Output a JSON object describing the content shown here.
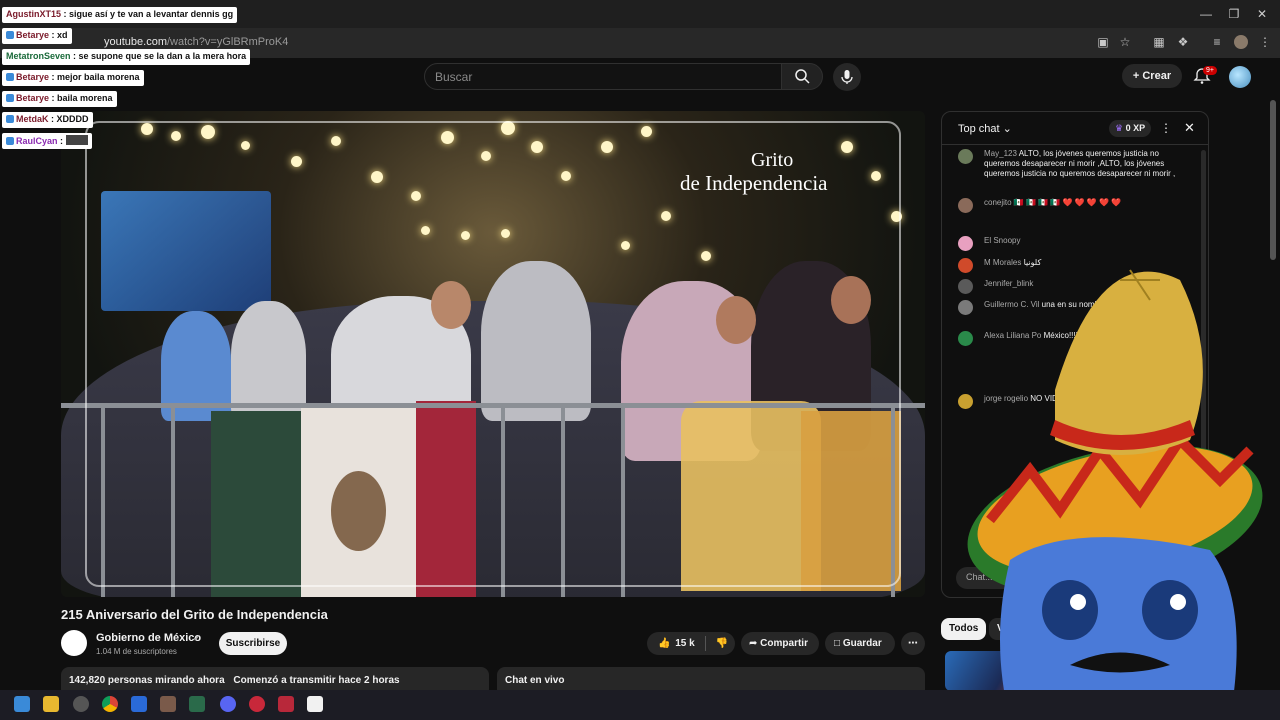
{
  "browser": {
    "url_host": "youtube.com",
    "url_path": "/watch?v=yGlBRmProK4"
  },
  "header": {
    "search_placeholder": "Buscar",
    "create_label": "Crear",
    "notif_badge": "9+"
  },
  "video": {
    "overlay_title_line1": "Grito",
    "overlay_title_line2": "de Independencia",
    "title": "215 Aniversario del Grito de Independencia",
    "channel_name": "Gobierno de México",
    "subscribers": "1.04 M de suscriptores",
    "subscribe_label": "Suscribirse",
    "likes": "15 k",
    "share_label": "Compartir",
    "save_label": "Guardar",
    "watching": "142,820 personas mirando ahora",
    "started": "Comenzó a transmitir hace 2 horas",
    "live_chat_label": "Chat en vivo"
  },
  "chat": {
    "header_title": "Top chat",
    "xp": "0 XP",
    "input_placeholder": "Chat...",
    "messages": [
      {
        "author": "May_123",
        "text": "ALTO, los jóvenes queremos justicia no queremos desaparecer ni morir ,ALTO, los jóvenes queremos justicia no queremos desaparecer ni morir ,"
      },
      {
        "author": "conejito",
        "text": "🇲🇽 🇲🇽 🇲🇽 🇲🇽 ❤️ ❤️ ❤️ ❤️ ❤️"
      },
      {
        "author": "El Snoopy",
        "text": ""
      },
      {
        "author": "M Morales",
        "text": "كلونيا"
      },
      {
        "author": "Jennifer_blink",
        "text": ""
      },
      {
        "author": "Guillermo C. Vil",
        "text": "una en su nomb"
      },
      {
        "author": "Alexa Liliana Po",
        "text": "México!!!!!!!!!!!"
      },
      {
        "author": "jorge rogelio",
        "text": "NO VIDEOJUEGOS"
      }
    ]
  },
  "tabs": {
    "todos": "Todos",
    "videos": "Vide"
  },
  "overlay_chat": [
    {
      "user": "AgustinXT15",
      "text": "sigue así y te van a levantar dennis gg"
    },
    {
      "user": "Betarye",
      "text": "xd"
    },
    {
      "user": "MetatronSeven",
      "text": "se supone que se la dan a la mera hora"
    },
    {
      "user": "Betarye",
      "text": "mejor baila morena"
    },
    {
      "user": "Betarye",
      "text": "baila morena"
    },
    {
      "user": "MetdaK",
      "text": "XDDDD"
    },
    {
      "user": "RaulCyan",
      "text": ""
    }
  ],
  "colors": {
    "bg": "#0f0f0f",
    "accent_red": "#cc0000",
    "flag_green": "#2c4a3a",
    "flag_red": "#a3263a"
  }
}
